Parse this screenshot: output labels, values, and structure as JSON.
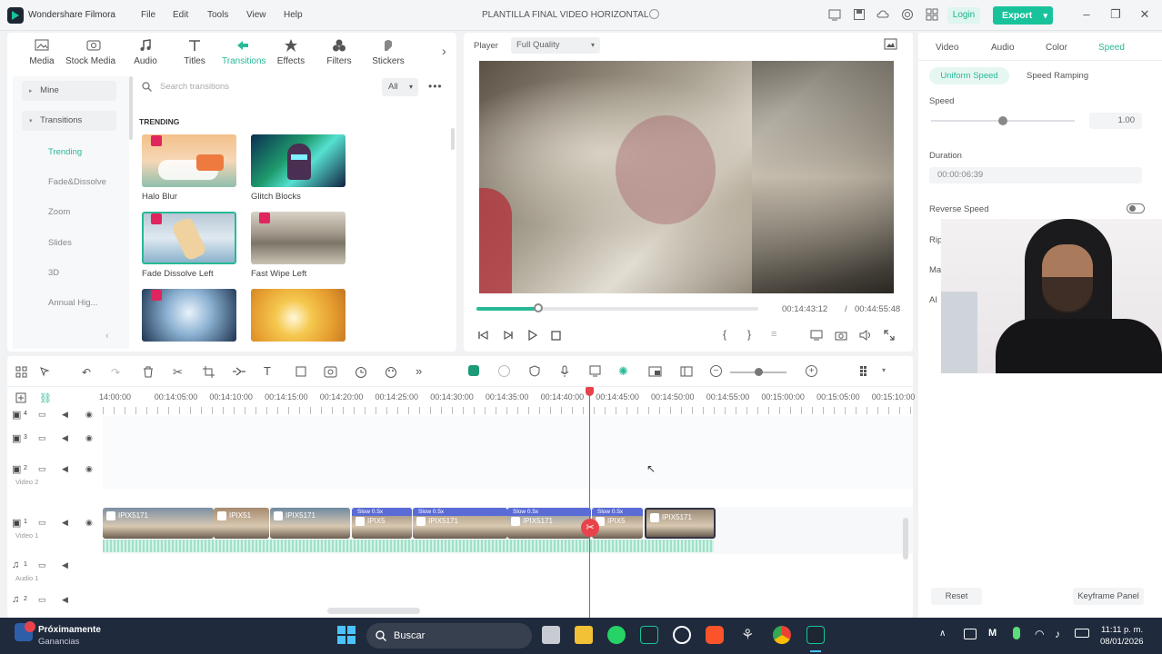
{
  "app": {
    "name": "Wondershare Filmora",
    "project": "PLANTILLA FINAL VIDEO HORIZONTAL"
  },
  "menu": [
    "File",
    "Edit",
    "Tools",
    "View",
    "Help"
  ],
  "header": {
    "login_label": "Login",
    "export_label": "Export"
  },
  "library": {
    "tabs": [
      "Media",
      "Stock Media",
      "Audio",
      "Titles",
      "Transitions",
      "Effects",
      "Filters",
      "Stickers"
    ],
    "active_tab": "Transitions",
    "sidebar": {
      "mine": "Mine",
      "transitions": "Transitions",
      "subs": [
        "Trending",
        "Fade&Dissolve",
        "Zoom",
        "Slides",
        "3D",
        "Annual Hig..."
      ]
    },
    "search_placeholder": "Search transitions",
    "filter_value": "All",
    "section": "TRENDING",
    "items": [
      {
        "name": "Halo Blur",
        "premium": true
      },
      {
        "name": "Glitch Blocks",
        "premium": false
      },
      {
        "name": "Fade Dissolve Left",
        "premium": true
      },
      {
        "name": "Fast Wipe Left",
        "premium": true
      },
      {
        "name": "",
        "premium": true
      },
      {
        "name": "",
        "premium": false
      }
    ]
  },
  "player": {
    "label": "Player",
    "quality": "Full Quality",
    "current_time": "00:14:43:12",
    "separator": "/",
    "total_time": "00:44:55:48",
    "progress": 0.22
  },
  "properties": {
    "tabs": [
      "Video",
      "Audio",
      "Color",
      "Speed"
    ],
    "active_tab": "Speed",
    "mode_tabs": [
      "Uniform Speed",
      "Speed Ramping"
    ],
    "speed_label": "Speed",
    "speed_value": "1.00",
    "speed_slider": 0.5,
    "duration_label": "Duration",
    "duration_value": "00:00:06:39",
    "reverse_label": "Reverse Speed",
    "partial_labels": [
      "Rip",
      "Ma",
      "AI"
    ],
    "reset_label": "Reset",
    "keyframe_label": "Keyframe Panel"
  },
  "timeline": {
    "ruler": [
      "14:00:00",
      "00:14:05:00",
      "00:14:10:00",
      "00:14:15:00",
      "00:14:20:00",
      "00:14:25:00",
      "00:14:30:00",
      "00:14:35:00",
      "00:14:40:00",
      "00:14:45:00",
      "00:14:50:00",
      "00:14:55:00",
      "00:15:00:00",
      "00:15:05:00",
      "00:15:10:00"
    ],
    "tracks": [
      {
        "id": "4",
        "name": ""
      },
      {
        "id": "3",
        "name": ""
      },
      {
        "id": "2",
        "name": "Video 2"
      },
      {
        "id": "1",
        "name": "Video 1"
      },
      {
        "id": "1",
        "name": "Audio 1"
      },
      {
        "id": "2",
        "name": ""
      }
    ],
    "clips": [
      {
        "label": "IPIX5171"
      },
      {
        "label": "IPIX51"
      },
      {
        "label": "IPIX5171"
      },
      {
        "label": "IPIX5",
        "speed": "Slow 0.5x"
      },
      {
        "label": "IPIX5171",
        "speed": "Slow 0.5x"
      },
      {
        "label": "IPIX5171",
        "speed": "Slow 0.5x"
      },
      {
        "label": "IPIX5",
        "speed": "Slow 0.5x"
      },
      {
        "label": "IPIX5171"
      }
    ]
  },
  "taskbar": {
    "widget_title": "Próximamente",
    "widget_sub": "Ganancias",
    "search_label": "Buscar",
    "time": "11:11 p. m.",
    "date": "08/01/2026"
  },
  "colors": {
    "accent": "#18c39b",
    "playhead": "#e8434b",
    "timeline_bg": "#ffffff",
    "taskbar": "#1f2a3c"
  }
}
